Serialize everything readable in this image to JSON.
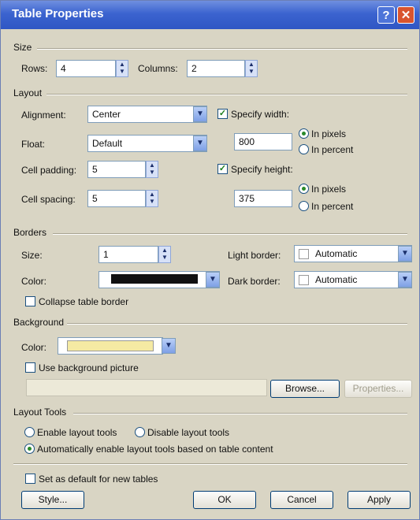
{
  "window": {
    "title": "Table Properties",
    "help_glyph": "?",
    "close_glyph": "✕"
  },
  "size": {
    "section": "Size",
    "rows_label": "Rows:",
    "rows_value": "4",
    "columns_label": "Columns:",
    "columns_value": "2"
  },
  "layout": {
    "section": "Layout",
    "alignment_label": "Alignment:",
    "alignment_value": "Center",
    "float_label": "Float:",
    "float_value": "Default",
    "cell_padding_label": "Cell padding:",
    "cell_padding_value": "5",
    "cell_spacing_label": "Cell spacing:",
    "cell_spacing_value": "5",
    "specify_width_label": "Specify width:",
    "specify_width_checked": true,
    "width_value": "800",
    "in_pixels_label": "In pixels",
    "in_percent_label": "In percent",
    "width_unit": "pixels",
    "specify_height_label": "Specify height:",
    "specify_height_checked": true,
    "height_value": "375",
    "height_unit": "pixels"
  },
  "borders": {
    "section": "Borders",
    "size_label": "Size:",
    "size_value": "1",
    "color_label": "Color:",
    "color_swatch": "#111111",
    "light_border_label": "Light border:",
    "light_border_value": "Automatic",
    "dark_border_label": "Dark border:",
    "dark_border_value": "Automatic",
    "collapse_label": "Collapse table border",
    "collapse_checked": false
  },
  "background": {
    "section": "Background",
    "color_label": "Color:",
    "color_swatch": "#f5eaa3",
    "use_picture_label": "Use background picture",
    "use_picture_checked": false,
    "picture_path": "",
    "browse_label": "Browse...",
    "properties_label": "Properties..."
  },
  "layout_tools": {
    "section": "Layout Tools",
    "enable_label": "Enable layout tools",
    "disable_label": "Disable layout tools",
    "auto_label": "Automatically enable layout tools based on table content",
    "selected": "auto"
  },
  "footer": {
    "set_default_label": "Set as default for new tables",
    "set_default_checked": false,
    "style_label": "Style...",
    "ok_label": "OK",
    "cancel_label": "Cancel",
    "apply_label": "Apply"
  },
  "icons": [
    "help-icon",
    "close-icon",
    "spinner-arrows-icon",
    "dropdown-arrow-icon",
    "checkmark-icon"
  ]
}
